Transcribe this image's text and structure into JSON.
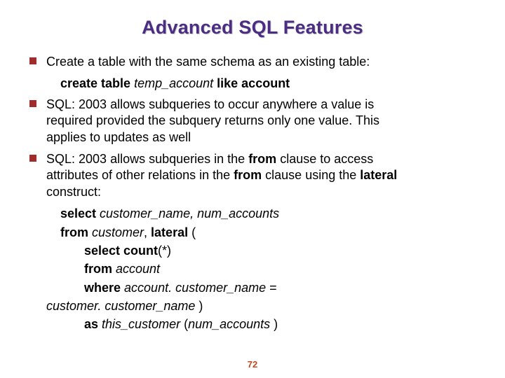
{
  "title": "Advanced SQL Features",
  "b1": {
    "text": "Create a table with the same schema as an existing table:",
    "code_pre": "create table ",
    "code_it": "temp_account",
    "code_post": " like account"
  },
  "b2": {
    "p1": "SQL: 2003 allows subqueries to occur anywhere a value is",
    "p2": "required provided the subquery returns only one value.  This",
    "p3": "applies to updates as well"
  },
  "b3": {
    "p1_a": "SQL: 2003 allows subqueries in the ",
    "p1_b": "from",
    "p1_c": " clause to access",
    "p2_a": "attributes of other relations in the ",
    "p2_b": "from",
    "p2_c": " clause using the ",
    "p2_d": "lateral",
    "p3": "construct:",
    "l1_a": "select ",
    "l1_b": "customer_name, num_accounts",
    "l2_a": "from ",
    "l2_b": "customer",
    "l2_c": ", ",
    "l2_d": "lateral",
    "l2_e": " (",
    "l3_a": "select count",
    "l3_b": "(*)",
    "l4_a": "from ",
    "l4_b": "account",
    "l5_a": "where ",
    "l5_b": "account. customer_name",
    "l5_c": " =",
    "l6_a": "customer. customer_name",
    "l6_b": " )",
    "l7_a": "as ",
    "l7_b": "this_customer",
    "l7_c": " (",
    "l7_d": "num_accounts",
    "l7_e": " )"
  },
  "page_num": "72"
}
